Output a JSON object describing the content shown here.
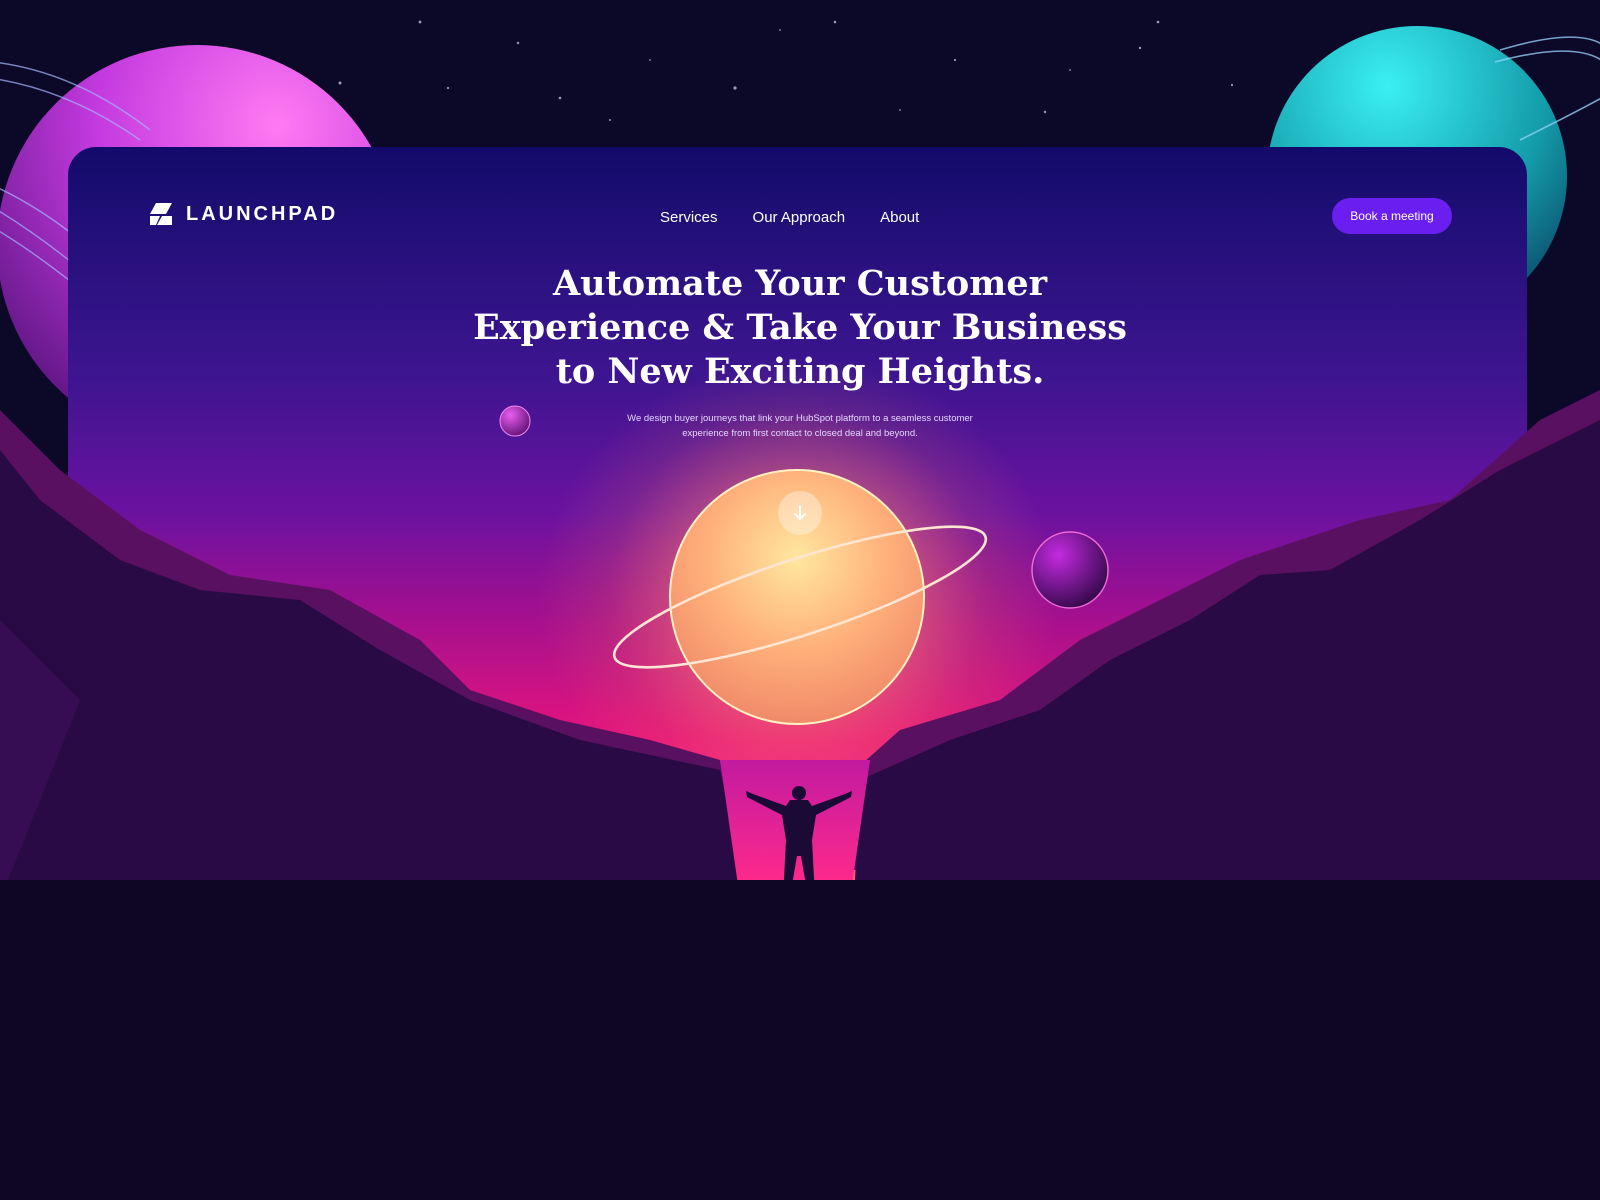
{
  "brand": {
    "name": "LAUNCHPAD",
    "logo_icon": "launchpad-logo-icon"
  },
  "nav": {
    "items": [
      {
        "label": "Services"
      },
      {
        "label": "Our Approach"
      },
      {
        "label": "About"
      }
    ],
    "cta_label": "Book a meeting"
  },
  "hero": {
    "title_lines": [
      "Automate Your Customer",
      "Experience & Take Your Business",
      "to New Exciting Heights."
    ],
    "subtitle_lines": [
      "We design buyer journeys that link your HubSpot platform to a seamless customer",
      "experience from first contact to closed deal and beyond."
    ],
    "scroll_icon": "arrow-down-icon"
  },
  "colors": {
    "background": "#0c0928",
    "accent": "#6a1ff0",
    "sun": "#ffd27a",
    "mountain_dark": "#1a0a35"
  }
}
